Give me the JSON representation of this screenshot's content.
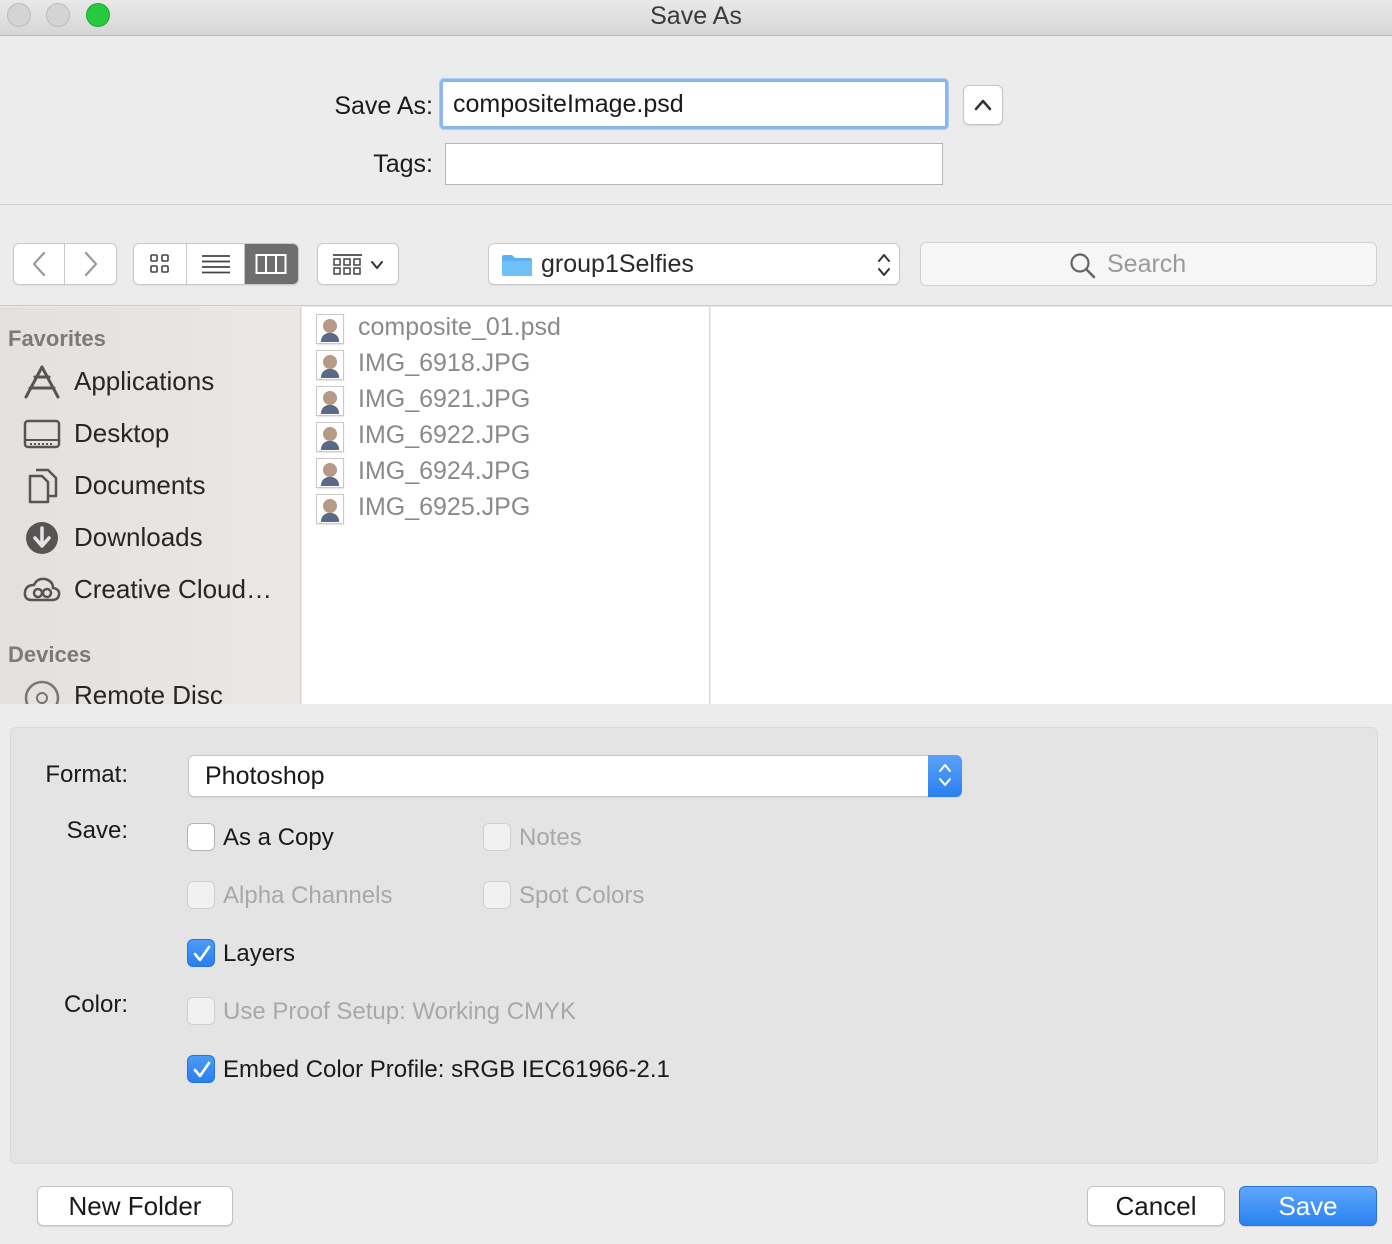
{
  "window": {
    "title": "Save As"
  },
  "save_form": {
    "save_as_label": "Save As:",
    "filename": "compositeImage.psd",
    "tags_label": "Tags:",
    "tags_value": ""
  },
  "toolbar": {
    "current_folder": "group1Selfies",
    "search_placeholder": "Search",
    "active_view": "columns"
  },
  "sidebar": {
    "favorites_header": "Favorites",
    "favorites": [
      {
        "label": "Applications",
        "icon": "applications-icon"
      },
      {
        "label": "Desktop",
        "icon": "desktop-icon"
      },
      {
        "label": "Documents",
        "icon": "documents-icon"
      },
      {
        "label": "Downloads",
        "icon": "downloads-icon"
      },
      {
        "label": "Creative Cloud…",
        "icon": "creative-cloud-icon"
      }
    ],
    "devices_header": "Devices",
    "devices": [
      {
        "label": "Remote Disc",
        "icon": "disc-icon"
      }
    ]
  },
  "files": [
    {
      "name": "composite_01.psd"
    },
    {
      "name": "IMG_6918.JPG"
    },
    {
      "name": "IMG_6921.JPG"
    },
    {
      "name": "IMG_6922.JPG"
    },
    {
      "name": "IMG_6924.JPG"
    },
    {
      "name": "IMG_6925.JPG"
    }
  ],
  "options": {
    "format_label": "Format:",
    "format_value": "Photoshop",
    "save_label": "Save:",
    "color_label": "Color:",
    "as_copy": {
      "label": "As a Copy",
      "checked": false
    },
    "notes": {
      "label": "Notes",
      "checked": false
    },
    "alpha_channels": {
      "label": "Alpha Channels",
      "checked": false
    },
    "spot_colors": {
      "label": "Spot Colors",
      "checked": false
    },
    "layers": {
      "label": "Layers",
      "checked": true
    },
    "use_proof_setup": {
      "label": "Use Proof Setup:  Working CMYK",
      "checked": false
    },
    "embed_color_profile": {
      "label": "Embed Color Profile:  sRGB IEC61966-2.1",
      "checked": true
    }
  },
  "buttons": {
    "new_folder": "New Folder",
    "cancel": "Cancel",
    "save": "Save"
  },
  "colors": {
    "accent": "#2c82f2",
    "traffic_zoom": "#27c93f",
    "folder": "#5ab0f0"
  }
}
